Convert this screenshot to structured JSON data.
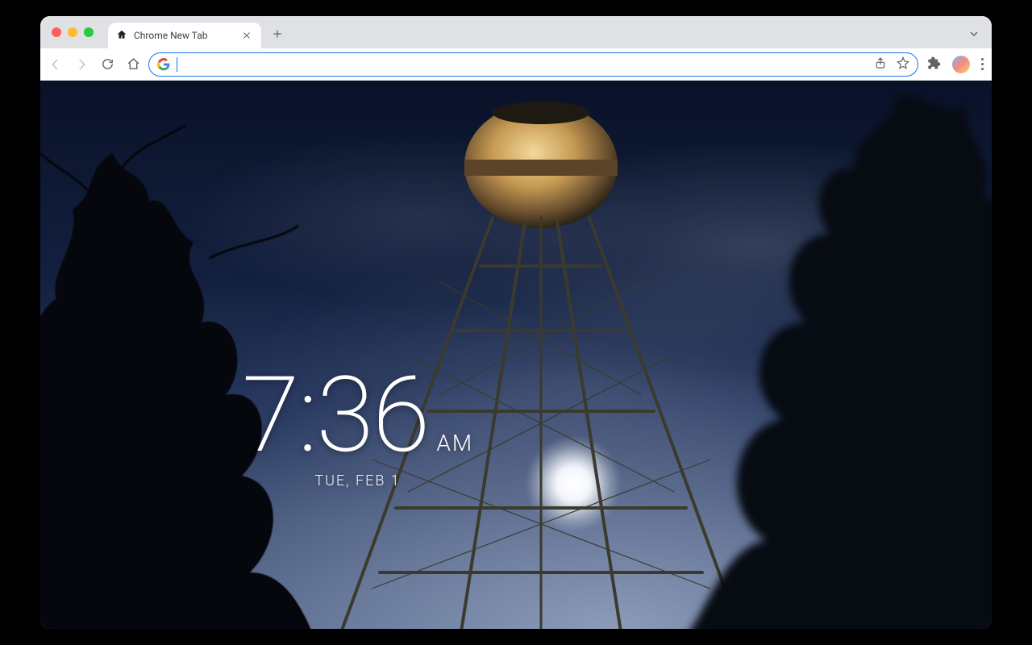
{
  "tab": {
    "title": "Chrome New Tab"
  },
  "clock": {
    "time": "7:36",
    "ampm": "AM",
    "date": "TUE, FEB 1"
  },
  "colors": {
    "omnibox_focus": "#1a73e8"
  }
}
